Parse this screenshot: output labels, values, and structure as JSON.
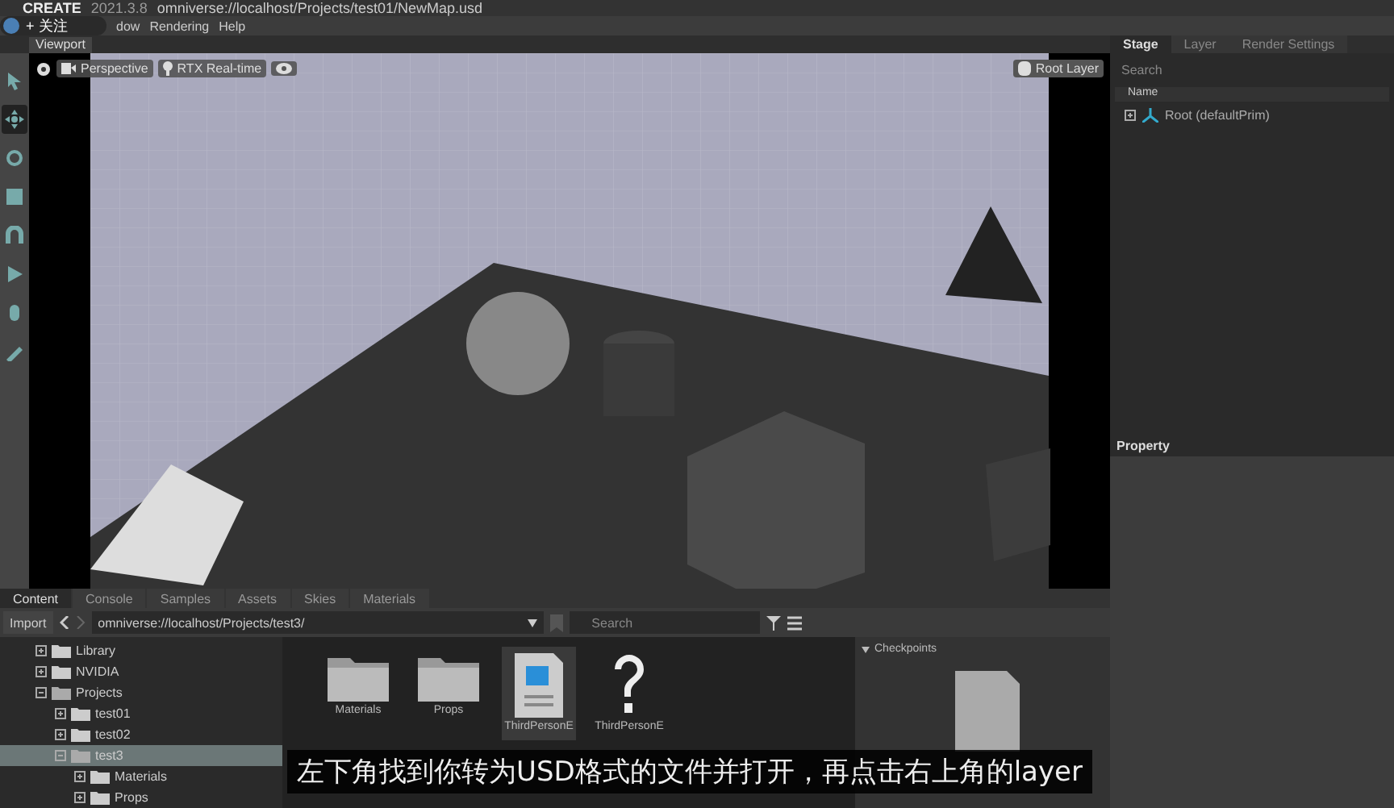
{
  "title_bar": {
    "app": "CREATE",
    "version": "2021.3.8",
    "path": "omniverse://localhost/Projects/test01/NewMap.usd"
  },
  "follow_button": {
    "label": "+ 关注"
  },
  "menu": [
    "dow",
    "Rendering",
    "Help"
  ],
  "viewport": {
    "tab": "Viewport",
    "camera": "Perspective",
    "renderer": "RTX Real-time",
    "layer": "Root Layer"
  },
  "tools": [
    {
      "kind": "select",
      "selected": false
    },
    {
      "kind": "move",
      "selected": true
    },
    {
      "kind": "rotate",
      "selected": false
    },
    {
      "kind": "scale",
      "selected": false
    },
    {
      "kind": "snap",
      "selected": false
    },
    {
      "kind": "play",
      "selected": false
    },
    {
      "kind": "paint",
      "selected": false
    },
    {
      "kind": "brush",
      "selected": false
    }
  ],
  "stage": {
    "tabs": [
      {
        "label": "Stage",
        "selected": true
      },
      {
        "label": "Layer",
        "selected": false
      },
      {
        "label": "Render Settings",
        "selected": false
      }
    ],
    "search": {
      "placeholder": "Search"
    },
    "column": "Name",
    "rows": [
      {
        "label": "Root (defaultPrim)"
      }
    ],
    "property_tab": "Property"
  },
  "content": {
    "tabs": [
      {
        "label": "Content",
        "selected": true
      },
      {
        "label": "Console",
        "selected": false
      },
      {
        "label": "Samples",
        "selected": false
      },
      {
        "label": "Assets",
        "selected": false
      },
      {
        "label": "Skies",
        "selected": false
      },
      {
        "label": "Materials",
        "selected": false
      }
    ],
    "import": "Import",
    "path": "omniverse://localhost/Projects/test3/",
    "search": {
      "placeholder": "Search"
    },
    "tree": [
      {
        "label": "Library",
        "expanded": false,
        "selected": false
      },
      {
        "label": "NVIDIA",
        "expanded": false,
        "selected": false
      },
      {
        "label": "Projects",
        "expanded": true,
        "selected": false,
        "children": [
          {
            "label": "test01",
            "expanded": false,
            "selected": false
          },
          {
            "label": "test02",
            "expanded": false,
            "selected": false
          },
          {
            "label": "test3",
            "expanded": true,
            "selected": true,
            "children": [
              {
                "label": "Materials",
                "expanded": false,
                "selected": false
              },
              {
                "label": "Props",
                "expanded": false,
                "selected": false
              }
            ]
          }
        ]
      }
    ],
    "files": [
      {
        "kind": "folder",
        "label": "Materials",
        "selected": false
      },
      {
        "kind": "folder",
        "label": "Props",
        "selected": false
      },
      {
        "kind": "usd",
        "label": "ThirdPersonE",
        "selected": true
      },
      {
        "kind": "unknown",
        "label": "ThirdPersonE",
        "selected": false
      }
    ],
    "checkpoints": "Checkpoints"
  },
  "subtitle": "左下角找到你转为USD格式的文件并打开，再点击右上角的layer"
}
